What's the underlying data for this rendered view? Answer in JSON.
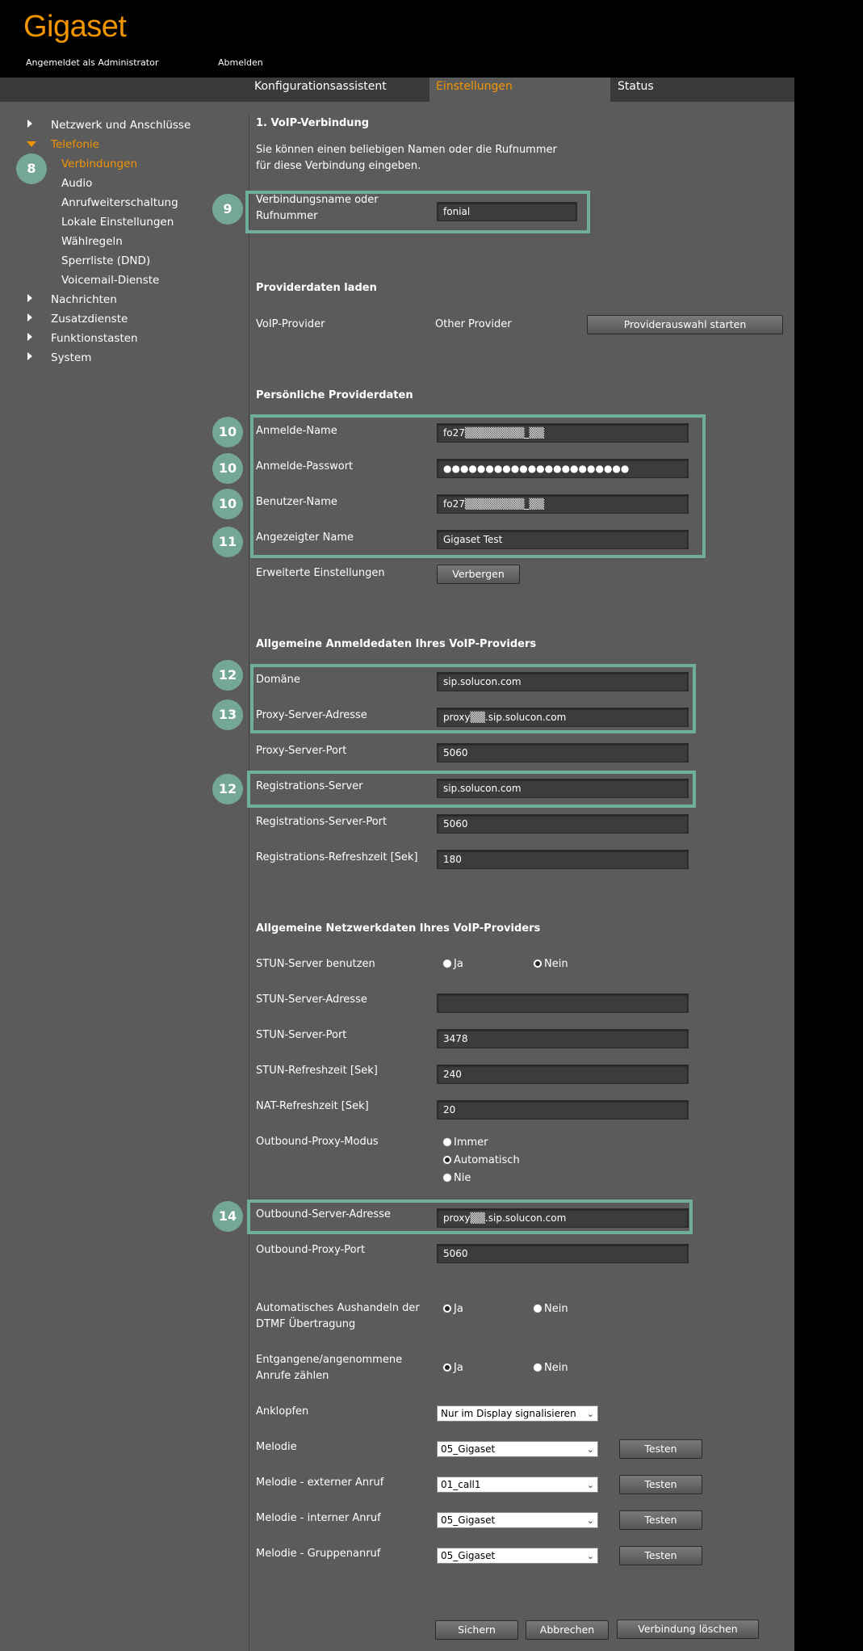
{
  "header": {
    "logo": "Gigaset",
    "logged_in": "Angemeldet als Administrator",
    "logout": "Abmelden"
  },
  "tabs": [
    {
      "label": "Konfigurationsassistent"
    },
    {
      "label": "Einstellungen"
    },
    {
      "label": "Status"
    }
  ],
  "sidebar": {
    "items": [
      {
        "label": "Netzwerk und Anschlüsse"
      },
      {
        "label": "Telefonie"
      },
      {
        "label": "Verbindungen"
      },
      {
        "label": "Audio"
      },
      {
        "label": "Anrufweiterschaltung"
      },
      {
        "label": "Lokale Einstellungen"
      },
      {
        "label": "Wählregeln"
      },
      {
        "label": "Sperrliste (DND)"
      },
      {
        "label": "Voicemail-Dienste"
      },
      {
        "label": "Nachrichten"
      },
      {
        "label": "Zusatzdienste"
      },
      {
        "label": "Funktionstasten"
      },
      {
        "label": "System"
      }
    ]
  },
  "badges": [
    "8",
    "9",
    "10",
    "10",
    "10",
    "11",
    "12",
    "13",
    "12",
    "14"
  ],
  "main": {
    "voip": {
      "title": "1. VoIP-Verbindung",
      "intro_1": "Sie können einen beliebigen Namen oder die Rufnummer",
      "intro_2": "für diese Verbindung eingeben.",
      "name_label_1": "Verbindungsname oder",
      "name_label_2": "Rufnummer",
      "name_value": "fonial"
    },
    "provider": {
      "title": "Providerdaten laden",
      "label": "VoIP-Provider",
      "value": "Other Provider",
      "button": "Providerauswahl starten"
    },
    "personal": {
      "title": "Persönliche Providerdaten",
      "login_name_label": "Anmelde-Name",
      "login_name_value": "fo27▒▒▒▒▒▒▒▒_▒▒",
      "password_label": "Anmelde-Passwort",
      "password_value": "●●●●●●●●●●●●●●●●●●●●●●",
      "user_name_label": "Benutzer-Name",
      "user_name_value": "fo27▒▒▒▒▒▒▒▒_▒▒",
      "display_name_label": "Angezeigter Name",
      "display_name_value": "Gigaset Test",
      "advanced_label": "Erweiterte Einstellungen",
      "advanced_button": "Verbergen"
    },
    "login_data": {
      "title": "Allgemeine Anmeldedaten Ihres VoIP-Providers",
      "domain_label": "Domäne",
      "domain_value": "sip.solucon.com",
      "proxy_label": "Proxy-Server-Adresse",
      "proxy_value": "proxy▒▒.sip.solucon.com",
      "proxy_port_label": "Proxy-Server-Port",
      "proxy_port_value": "5060",
      "reg_server_label": "Registrations-Server",
      "reg_server_value": "sip.solucon.com",
      "reg_port_label": "Registrations-Server-Port",
      "reg_port_value": "5060",
      "reg_refresh_label": "Registrations-Refreshzeit [Sek]",
      "reg_refresh_value": "180"
    },
    "network": {
      "title": "Allgemeine Netzwerkdaten Ihres VoIP-Providers",
      "stun_use_label": "STUN-Server benutzen",
      "yes": "Ja",
      "no": "Nein",
      "stun_addr_label": "STUN-Server-Adresse",
      "stun_addr_value": "",
      "stun_port_label": "STUN-Server-Port",
      "stun_port_value": "3478",
      "stun_refresh_label": "STUN-Refreshzeit [Sek]",
      "stun_refresh_value": "240",
      "nat_refresh_label": "NAT-Refreshzeit [Sek]",
      "nat_refresh_value": "20",
      "outbound_mode_label": "Outbound-Proxy-Modus",
      "mode_always": "Immer",
      "mode_auto": "Automatisch",
      "mode_never": "Nie",
      "outbound_addr_label": "Outbound-Server-Adresse",
      "outbound_addr_value": "proxy▒▒.sip.solucon.com",
      "outbound_port_label": "Outbound-Proxy-Port",
      "outbound_port_value": "5060"
    },
    "misc": {
      "dtmf_label_1": "Automatisches Aushandeln der",
      "dtmf_label_2": "DTMF Übertragung",
      "count_label_1": "Entgangene/angenommene",
      "count_label_2": "Anrufe zählen",
      "yes": "Ja",
      "no": "Nein",
      "knock_label": "Anklopfen",
      "knock_value": "Nur im Display signalisieren",
      "melody_label": "Melodie",
      "melody_value": "05_Gigaset",
      "melody_ext_label": "Melodie - externer Anruf",
      "melody_ext_value": "01_call1",
      "melody_int_label": "Melodie - interner Anruf",
      "melody_int_value": "05_Gigaset",
      "melody_grp_label": "Melodie - Gruppenanruf",
      "melody_grp_value": "05_Gigaset",
      "test_button": "Testen"
    },
    "footer": {
      "save": "Sichern",
      "cancel": "Abbrechen",
      "delete": "Verbindung löschen"
    }
  },
  "colors": {
    "accent": "#f29400",
    "panel": "#5b5b5b",
    "highlight": "#6fae9c",
    "badge": "#74a796"
  }
}
